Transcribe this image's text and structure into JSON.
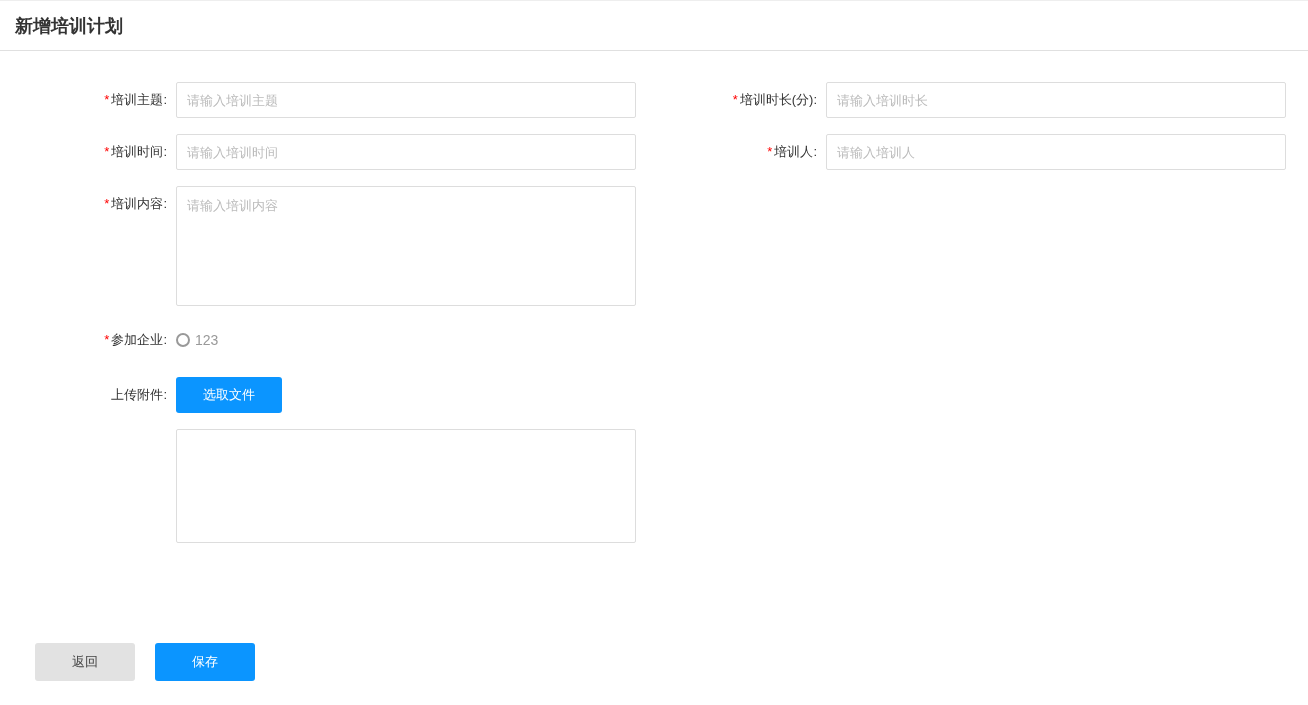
{
  "page": {
    "title": "新增培训计划"
  },
  "left_fields": [
    {
      "kind": "input",
      "label": "培训主题:",
      "required_mark": "*",
      "placeholder": "请输入培训主题"
    },
    {
      "kind": "input",
      "label": "培训时间:",
      "required_mark": "*",
      "placeholder": "请输入培训时间"
    },
    {
      "kind": "textarea",
      "label": "培训内容:",
      "required_mark": "*",
      "placeholder": "请输入培训内容"
    },
    {
      "kind": "radio",
      "label": "参加企业:",
      "required_mark": "*",
      "options": [
        {
          "label": "123",
          "selected": false
        }
      ]
    },
    {
      "kind": "upload",
      "label": "上传附件:",
      "button": "选取文件"
    }
  ],
  "right_fields": [
    {
      "kind": "input",
      "label": "培训时长(分):",
      "required_mark": "*",
      "placeholder": "请输入培训时长"
    },
    {
      "kind": "input",
      "label": "培训人:",
      "required_mark": "*",
      "placeholder": "请输入培训人"
    }
  ],
  "actions": [
    {
      "label": "返回",
      "kind": "secondary"
    },
    {
      "label": "保存",
      "kind": "primary"
    }
  ]
}
